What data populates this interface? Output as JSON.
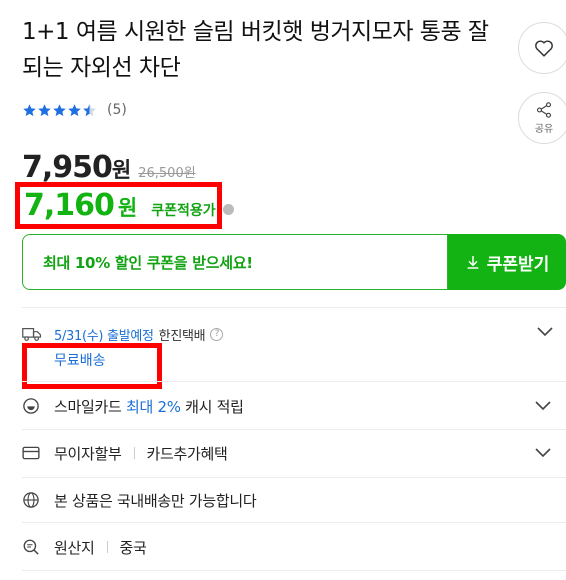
{
  "product": {
    "title": "1+1 여름 시원한 슬림 버킷햇 벙거지모자 통풍 잘되는 자외선 차단",
    "review_count": "(5)",
    "rating": 4.5
  },
  "actions": {
    "share_label": "공유"
  },
  "price": {
    "sale_price": "7,950",
    "currency": "원",
    "original_price": "26,500원",
    "coupon_price": "7,160",
    "coupon_currency": "원",
    "coupon_tag": "쿠폰적용가"
  },
  "coupon": {
    "banner_text": "최대 10% 할인 쿠폰을 받으세요!",
    "button_label": "쿠폰받기"
  },
  "shipping": {
    "date": "5/31(수) 출발예정",
    "carrier": "한진택배",
    "help": "?",
    "free_shipping": "무료배송"
  },
  "smile_card": {
    "prefix": "스마일카드",
    "highlight": "최대 2%",
    "suffix": "캐시 적립"
  },
  "installment": {
    "label": "무이자할부",
    "benefit": "카드추가혜택"
  },
  "domestic": {
    "text": "본 상품은 국내배송만 가능합니다"
  },
  "origin": {
    "label": "원산지",
    "value": "중국"
  },
  "colors": {
    "green": "#12b312",
    "blue": "#1a6fd6",
    "highlight_red": "#ff0000",
    "star": "#1f6fe0"
  }
}
